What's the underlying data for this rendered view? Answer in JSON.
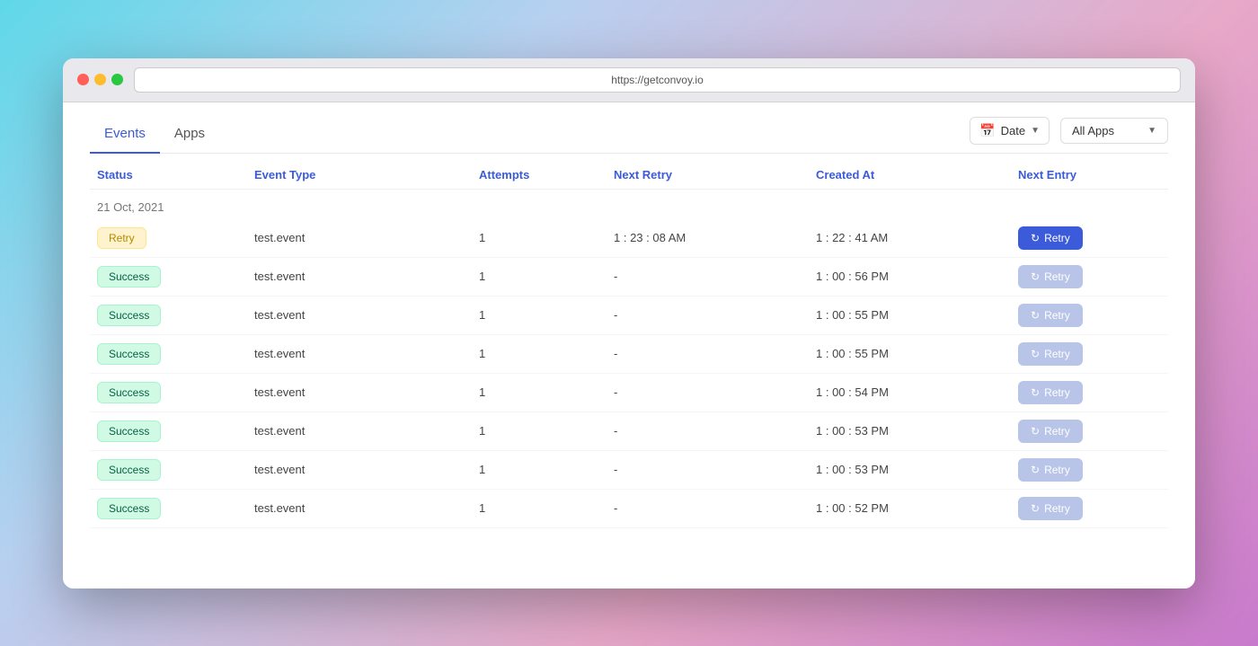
{
  "browser": {
    "url": "https://getconvoy.io"
  },
  "tabs": [
    {
      "id": "events",
      "label": "Events",
      "active": true
    },
    {
      "id": "apps",
      "label": "Apps",
      "active": false
    }
  ],
  "filters": {
    "date_label": "Date",
    "app_select_label": "All Apps"
  },
  "table": {
    "columns": [
      {
        "id": "status",
        "label": "Status"
      },
      {
        "id": "event_type",
        "label": "Event Type"
      },
      {
        "id": "attempts",
        "label": "Attempts"
      },
      {
        "id": "next_retry",
        "label": "Next Retry"
      },
      {
        "id": "created_at",
        "label": "Created At"
      },
      {
        "id": "next_entry",
        "label": "Next Entry"
      }
    ],
    "date_group": "21 Oct, 2021",
    "rows": [
      {
        "status": "Retry",
        "status_type": "retry",
        "event_type": "test.event",
        "attempts": "1",
        "next_retry": "1 : 23 : 08 AM",
        "created_at": "1 : 22 : 41 AM",
        "btn_active": true
      },
      {
        "status": "Success",
        "status_type": "success",
        "event_type": "test.event",
        "attempts": "1",
        "next_retry": "-",
        "created_at": "1 : 00 : 56 PM",
        "btn_active": false
      },
      {
        "status": "Success",
        "status_type": "success",
        "event_type": "test.event",
        "attempts": "1",
        "next_retry": "-",
        "created_at": "1 : 00 : 55 PM",
        "btn_active": false
      },
      {
        "status": "Success",
        "status_type": "success",
        "event_type": "test.event",
        "attempts": "1",
        "next_retry": "-",
        "created_at": "1 : 00 : 55 PM",
        "btn_active": false
      },
      {
        "status": "Success",
        "status_type": "success",
        "event_type": "test.event",
        "attempts": "1",
        "next_retry": "-",
        "created_at": "1 : 00 : 54 PM",
        "btn_active": false
      },
      {
        "status": "Success",
        "status_type": "success",
        "event_type": "test.event",
        "attempts": "1",
        "next_retry": "-",
        "created_at": "1 : 00 : 53 PM",
        "btn_active": false
      },
      {
        "status": "Success",
        "status_type": "success",
        "event_type": "test.event",
        "attempts": "1",
        "next_retry": "-",
        "created_at": "1 : 00 : 53 PM",
        "btn_active": false
      },
      {
        "status": "Success",
        "status_type": "success",
        "event_type": "test.event",
        "attempts": "1",
        "next_retry": "-",
        "created_at": "1 : 00 : 52 PM",
        "btn_active": false
      }
    ],
    "retry_button_label": "Retry"
  }
}
